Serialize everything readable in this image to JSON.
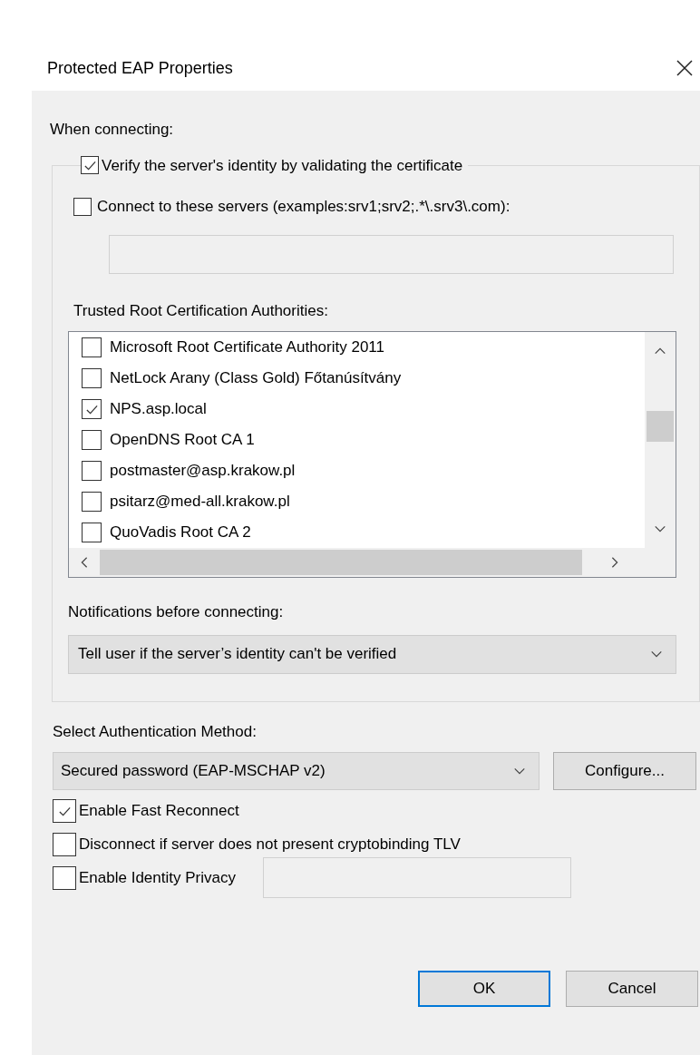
{
  "window": {
    "title": "Protected EAP Properties"
  },
  "when_connecting": {
    "label": "When connecting:",
    "verify": {
      "label": "Verify the server's identity by validating the certificate",
      "checked": true
    },
    "connect_servers": {
      "label": "Connect to these servers (examples:srv1;srv2;.*\\.srv3\\.com):",
      "checked": false
    },
    "trusted_root_label": "Trusted Root Certification Authorities:",
    "certificates": [
      {
        "name": "Microsoft Root Certificate Authority 2011",
        "checked": false
      },
      {
        "name": "NetLock Arany (Class Gold) Főtanúsítvány",
        "checked": false
      },
      {
        "name": "NPS.asp.local",
        "checked": true
      },
      {
        "name": "OpenDNS Root CA 1",
        "checked": false
      },
      {
        "name": "postmaster@asp.krakow.pl",
        "checked": false
      },
      {
        "name": "psitarz@med-all.krakow.pl",
        "checked": false
      },
      {
        "name": "QuoVadis Root CA 2",
        "checked": false
      }
    ],
    "notifications": {
      "label": "Notifications before connecting:",
      "value": "Tell user if the server’s identity can't be verified"
    }
  },
  "authentication": {
    "label": "Select Authentication Method:",
    "method": "Secured password (EAP-MSCHAP v2)",
    "configure_button": "Configure..."
  },
  "options": [
    {
      "kind": "plain",
      "label": "Enable Fast Reconnect",
      "checked": true
    },
    {
      "kind": "plain",
      "label": "Disconnect if server does not present cryptobinding TLV",
      "checked": false
    },
    {
      "kind": "with-field",
      "label": "Enable Identity Privacy",
      "checked": false
    }
  ],
  "buttons": [
    {
      "label": "OK",
      "default": true
    },
    {
      "label": "Cancel",
      "default": false
    }
  ]
}
